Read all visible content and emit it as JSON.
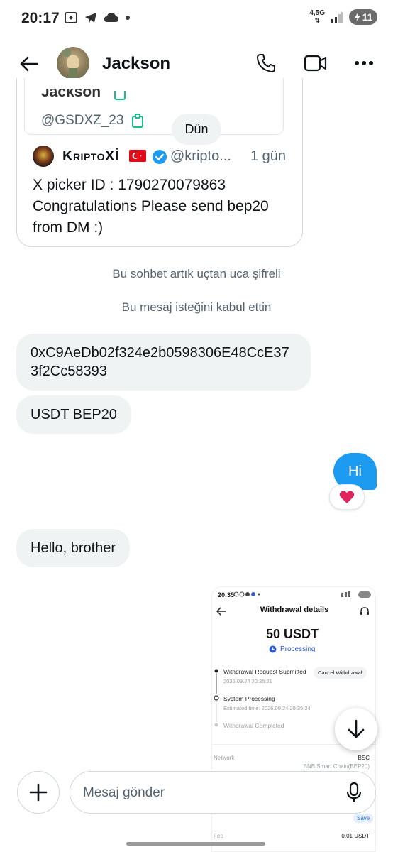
{
  "status_bar": {
    "time": "20:17",
    "network": "4,5G",
    "battery": "11"
  },
  "header": {
    "contact_name": "Jackson",
    "icons": [
      "back-arrow-icon",
      "phone-icon",
      "video-icon",
      "more-icon"
    ]
  },
  "quoted": {
    "cut_name": "Jackson",
    "handle": "@GSDXZ_23",
    "day_divider": "Dün",
    "tweet": {
      "author": "KriptoXİ",
      "handle": "@kripto...",
      "time": "1 gün",
      "text": "X picker ID : 1790270079863 Congratulations Please send bep20 from DM :)"
    }
  },
  "system_messages": {
    "encrypted": "Bu sohbet artık uçtan uca şifreli",
    "accepted": "Bu mesaj isteğini kabul ettin"
  },
  "messages": [
    {
      "direction": "in",
      "text": "0xC9AeDb02f324e2b0598306E48CcE373f2Cc58393"
    },
    {
      "direction": "in",
      "text": "USDT BEP20"
    },
    {
      "direction": "out",
      "text": "Hi",
      "reaction": "❤️"
    },
    {
      "direction": "in",
      "text": "Hello, brother"
    }
  ],
  "attachment": {
    "time": "20:35",
    "title": "Withdrawal details",
    "amount": "50 USDT",
    "status": "Processing",
    "steps": [
      {
        "label": "Withdrawal Request Submitted",
        "sub": "2026.09.24 20:35:21"
      },
      {
        "label": "System Processing",
        "sub": "Estimated time: 2026.09.24 20:35:34"
      },
      {
        "label": "Withdrawal Completed",
        "sub": ""
      }
    ],
    "cancel_label": "Cancel Withdrawal",
    "network_label": "Network",
    "network_value": "BSC",
    "network_sub": "BNB Smart Chain(BEP20)",
    "fee_label": "Fee",
    "fee_value": "0.01 USDT",
    "save_label": "Save"
  },
  "composer": {
    "placeholder": "Mesaj gönder",
    "value": ""
  }
}
